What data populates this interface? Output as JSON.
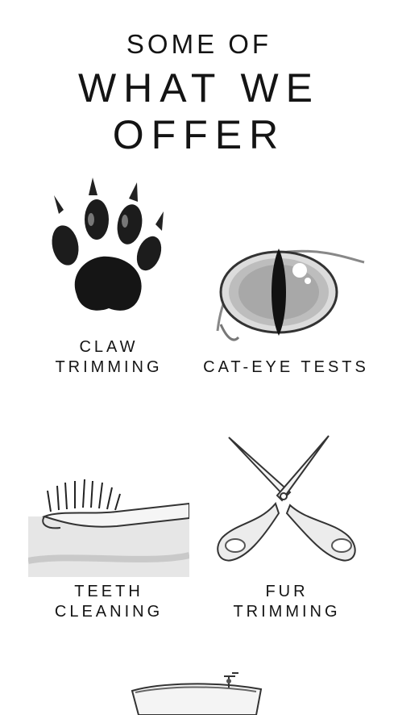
{
  "header": {
    "line1": "SOME OF",
    "line2": "WHAT WE",
    "line3": "OFFER"
  },
  "services": [
    {
      "label": "CLAW\nTRIMMING",
      "icon": "paw-print-icon"
    },
    {
      "label": "CAT-EYE TESTS",
      "icon": "cat-eye-icon"
    },
    {
      "label": "TEETH\nCLEANING",
      "icon": "toothbrush-icon"
    },
    {
      "label": "FUR\nTRIMMING",
      "icon": "scissors-icon"
    },
    {
      "label": "",
      "icon": "bathtub-icon"
    }
  ]
}
